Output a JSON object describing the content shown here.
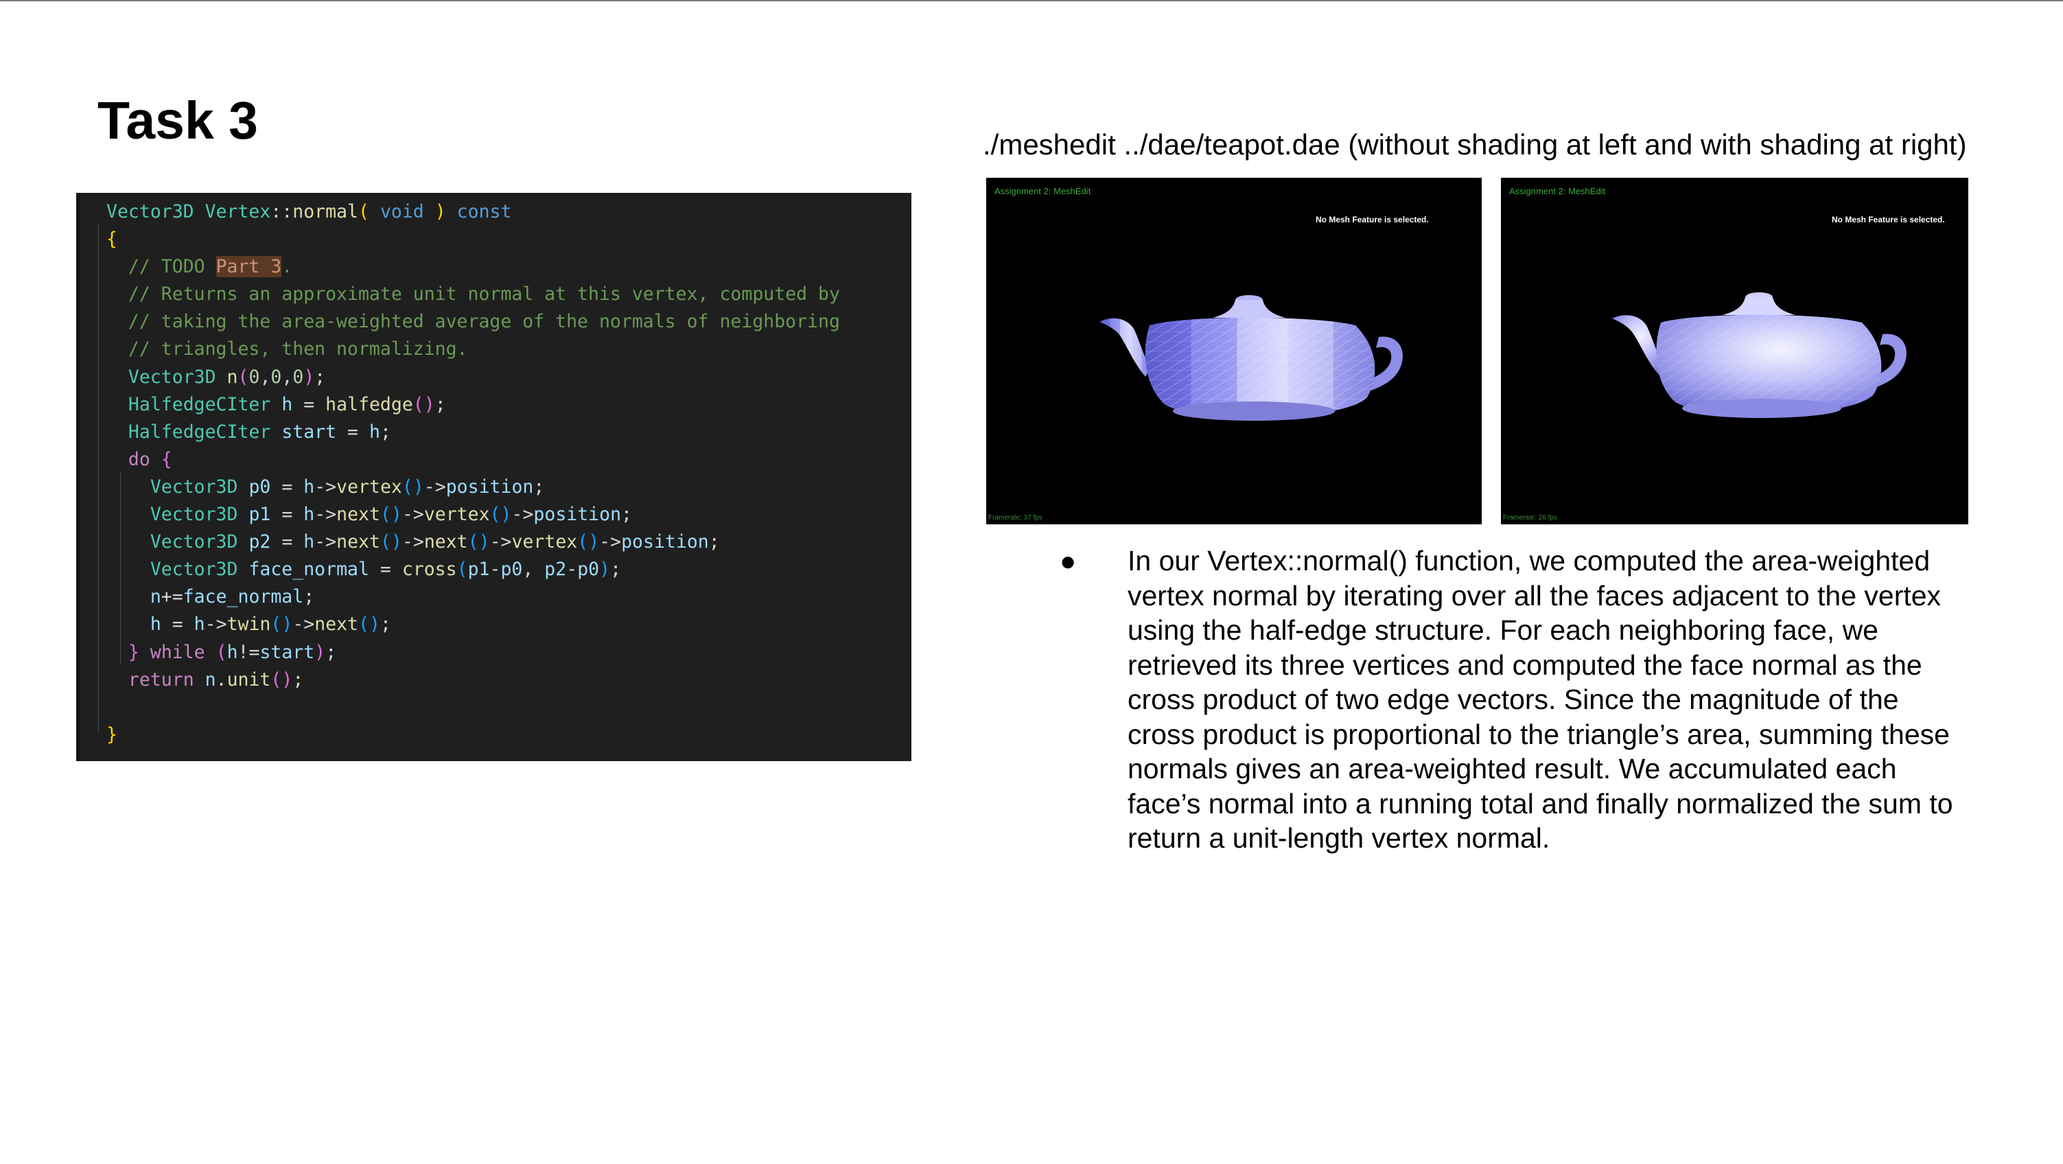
{
  "slide": {
    "title": "Task 3",
    "caption": "./meshedit ../dae/teapot.dae (without shading at left and with shading at right)",
    "bullet": "In our Vertex::normal() function, we computed the area-weighted vertex normal by iterating over all the faces adjacent to the vertex using the half-edge structure. For each neighboring face, we retrieved its three vertices and computed the face normal as the cross product of two edge vectors. Since the magnitude of the cross product is proportional to the triangle’s area, summing these normals gives an area-weighted result. We accumulated each face’s normal into a running total and finally normalized the sum to return a unit-length vertex normal."
  },
  "code": {
    "lines": [
      "Vector3D Vertex::normal( void ) const",
      "{",
      "  // TODO Part 3.",
      "  // Returns an approximate unit normal at this vertex, computed by",
      "  // taking the area-weighted average of the normals of neighboring",
      "  // triangles, then normalizing.",
      "  Vector3D n(0,0,0);",
      "  HalfedgeCIter h = halfedge();",
      "  HalfedgeCIter start = h;",
      "  do {",
      "    Vector3D p0 = h->vertex()->position;",
      "    Vector3D p1 = h->next()->vertex()->position;",
      "    Vector3D p2 = h->next()->next()->vertex()->position;",
      "    Vector3D face_normal = cross(p1-p0, p2-p0);",
      "    n+=face_normal;",
      "    h = h->twin()->next();",
      "  } while (h!=start);",
      "  return n.unit();",
      "",
      "}"
    ]
  },
  "screenshots": [
    {
      "window_title": "Assignment 2: MeshEdit",
      "message": "No Mesh Feature is selected.",
      "framerate": "Framerate: 37 fps",
      "shading": "flat"
    },
    {
      "window_title": "Assignment 2: MeshEdit",
      "message": "No Mesh Feature is selected.",
      "framerate": "Framerate: 26 fps",
      "shading": "smooth"
    }
  ],
  "colors": {
    "code_background": "#1f1f1f",
    "viewer_background": "#000000",
    "teapot": "#a9a9f5"
  }
}
